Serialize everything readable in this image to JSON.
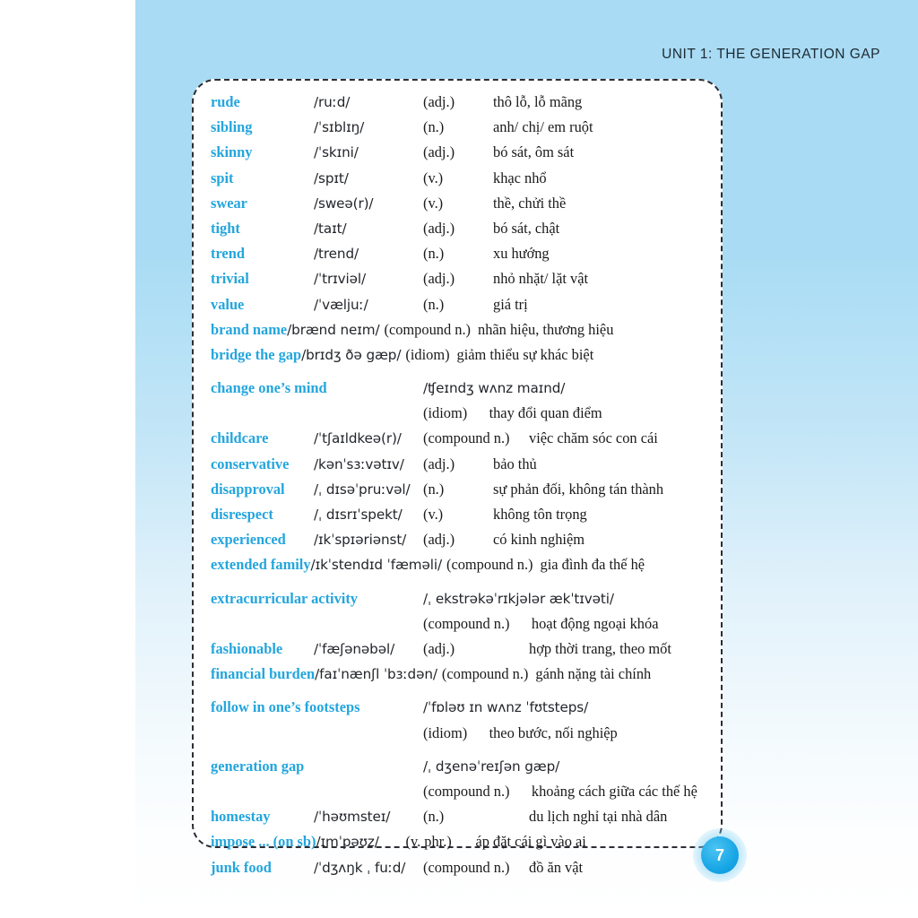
{
  "header": {
    "running_head": "UNIT 1: THE GENERATION GAP"
  },
  "page": {
    "number": "7",
    "accent_color": "#23a5dd",
    "background_top_color": "#a9dcf4",
    "background_bottom_color": "#ffffff",
    "panel_border_color": "#2d2d35"
  },
  "vocabulary": {
    "entries": [
      {
        "word": "rude",
        "ipa": "/ruːd/",
        "pos": "(adj.)",
        "meaning": "thô lỗ, lỗ mãng",
        "layout": "columns"
      },
      {
        "word": "sibling",
        "ipa": "/ˈsɪblɪŋ/",
        "pos": "(n.)",
        "meaning": "anh/ chị/ em ruột",
        "layout": "columns"
      },
      {
        "word": "skinny",
        "ipa": "/ˈskɪni/",
        "pos": "(adj.)",
        "meaning": "bó sát, ôm sát",
        "layout": "columns"
      },
      {
        "word": "spit",
        "ipa": "/spɪt/",
        "pos": "(v.)",
        "meaning": "khạc nhổ",
        "layout": "columns"
      },
      {
        "word": "swear",
        "ipa": "/sweə(r)/",
        "pos": "(v.)",
        "meaning": "thề, chửi thề",
        "layout": "columns"
      },
      {
        "word": "tight",
        "ipa": "/taɪt/",
        "pos": "(adj.)",
        "meaning": "bó sát, chật",
        "layout": "columns"
      },
      {
        "word": "trend",
        "ipa": "/trend/",
        "pos": "(n.)",
        "meaning": "xu hướng",
        "layout": "columns"
      },
      {
        "word": "trivial",
        "ipa": "/ˈtrɪviəl/",
        "pos": "(adj.)",
        "meaning": "nhỏ nhặt/ lặt vật",
        "layout": "columns"
      },
      {
        "word": "value",
        "ipa": "/ˈvæljuː/",
        "pos": "(n.)",
        "meaning": "giá trị",
        "layout": "columns"
      },
      {
        "word": "brand name",
        "ipa": "/brænd neɪm/",
        "pos": "(compound n.)",
        "meaning": "nhãn hiệu, thương hiệu",
        "layout": "inline"
      },
      {
        "word": "bridge the gap",
        "ipa": "/brɪdʒ ðə gæp/",
        "pos": "(idiom)",
        "meaning": "giảm thiểu sự khác biệt",
        "layout": "inline"
      },
      {
        "word": "change one’s mind",
        "ipa": "/ʧeɪndʒ wʌnz maɪnd/",
        "pos": "(idiom)",
        "meaning": "thay đổi quan điểm",
        "layout": "two-line"
      },
      {
        "word": "childcare",
        "ipa": "/ˈtʃaɪldkeə(r)/",
        "pos": "(compound n.)",
        "meaning": "việc chăm sóc con cái",
        "layout": "columns-wide-pos"
      },
      {
        "word": "conservative",
        "ipa": "/kənˈsɜːvətɪv/",
        "pos": "(adj.)",
        "meaning": "bảo thủ",
        "layout": "columns"
      },
      {
        "word": "disapproval",
        "ipa": "/ˌ dɪsəˈpruːvəl/",
        "pos": "(n.)",
        "meaning": "sự phản đối, không tán thành",
        "layout": "columns"
      },
      {
        "word": "disrespect",
        "ipa": "/ˌ dɪsrɪˈspekt/",
        "pos": "(v.)",
        "meaning": "không tôn trọng",
        "layout": "columns"
      },
      {
        "word": "experienced",
        "ipa": "/ɪkˈspɪəriənst/",
        "pos": "(adj.)",
        "meaning": "có kinh nghiệm",
        "layout": "columns"
      },
      {
        "word": "extended family",
        "ipa": "/ɪkˈstendɪd ˈfæməli/",
        "pos": "(compound n.)",
        "meaning": "gia đình đa thế hệ",
        "layout": "inline"
      },
      {
        "word": "extracurricular activity",
        "ipa": "/ˌ ekstrəkəˈrɪkjələr ækˈtɪvəti/",
        "pos": "(compound n.)",
        "meaning": "hoạt động ngoại khóa",
        "layout": "two-line-wide"
      },
      {
        "word": "fashionable",
        "ipa": "/ˈfæʃənəbəl/",
        "pos": "(adj.)",
        "meaning": "hợp thời trang, theo mốt",
        "layout": "columns-wide-pos"
      },
      {
        "word": "financial burden",
        "ipa": "/faɪˈnænʃl ˈbɜːdən/",
        "pos": "(compound n.)",
        "meaning": "gánh nặng tài chính",
        "layout": "inline"
      },
      {
        "word": "follow in one’s footsteps",
        "ipa": "/ˈfɒləʊ ɪn wʌnz ˈfʊtsteps/",
        "pos": "(idiom)",
        "meaning": "theo bước, nối nghiệp",
        "layout": "two-line-wide"
      },
      {
        "word": "generation gap",
        "ipa": "/ˌ dʒenəˈreɪʃən gæp/",
        "pos": "(compound n.)",
        "meaning": "khoảng cách giữa các thế hệ",
        "layout": "two-line-wide"
      },
      {
        "word": "homestay",
        "ipa": "/ˈhəʊmsteɪ/",
        "pos": "(n.)",
        "meaning": "du lịch nghỉ tại nhà dân",
        "layout": "columns-wide-pos"
      },
      {
        "word": "impose ... (on sb)",
        "ipa": "/ɪmˈpəʊz/",
        "pos": "(v. phr.)",
        "meaning": "áp đặt cái gì vào ai",
        "layout": "inline-pos"
      },
      {
        "word": "junk food",
        "ipa": "/ˈdʒʌŋk ˌ fuːd/",
        "pos": "(compound n.)",
        "meaning": "đồ ăn vật",
        "layout": "columns-wide-pos"
      }
    ]
  }
}
